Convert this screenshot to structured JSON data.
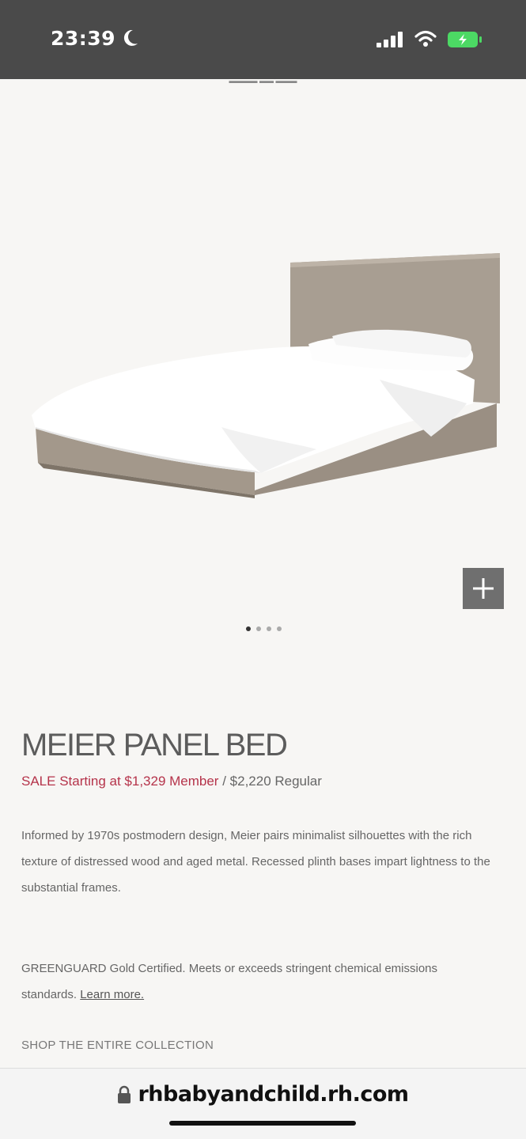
{
  "status_bar": {
    "time": "23:39",
    "icons": [
      "moon-icon",
      "cellular-signal-icon",
      "wifi-icon",
      "battery-charging-icon"
    ],
    "battery_color": "#4cd964"
  },
  "product": {
    "image_alt": "Meier Panel Bed product image",
    "carousel": {
      "total_slides": 4,
      "active_slide": 1
    },
    "title": "MEIER PANEL BED",
    "sale_text": "SALE Starting at $1,329 Member",
    "separator": " / ",
    "regular_text": "$2,220 Regular",
    "description": "Informed by 1970s postmodern design, Meier pairs minimalist silhouettes with the rich texture of distressed wood and aged metal. Recessed plinth bases impart lightness to the substantial frames.",
    "certification": "GREENGUARD Gold Certified. Meets or exceeds stringent chemical emissions standards.",
    "learn_more": "Learn more.",
    "shop_collection": "SHOP THE ENTIRE COLLECTION"
  },
  "colors": {
    "sale": "#b5334a",
    "accent_dark": "#4a4a4a"
  },
  "browser": {
    "url": "rhbabyandchild.rh.com",
    "lock_icon": "lock-icon"
  }
}
